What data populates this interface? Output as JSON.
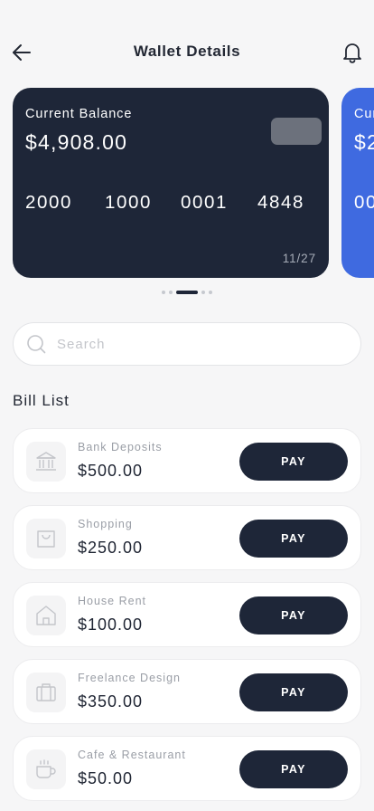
{
  "header": {
    "title": "Wallet Details",
    "back_icon": "arrow-left-icon",
    "notification_icon": "bell-icon"
  },
  "cards": [
    {
      "label": "Current Balance",
      "balance": "$4,908.00",
      "number": [
        "2000",
        "1000",
        "0001",
        "4848"
      ],
      "expiry": "11/27",
      "color": "#1e2638"
    },
    {
      "label": "Current Balance",
      "balance": "$2",
      "number": [
        "00"
      ],
      "color": "#3f6ae0"
    }
  ],
  "carousel": {
    "active_index": 2,
    "count": 5
  },
  "search": {
    "placeholder": "Search",
    "value": "",
    "icon": "search-icon"
  },
  "bills": {
    "title": "Bill List",
    "items": [
      {
        "name": "Bank Deposits",
        "amount": "$500.00",
        "icon": "bank-icon",
        "action": "PAY"
      },
      {
        "name": "Shopping",
        "amount": "$250.00",
        "icon": "shopping-bag-icon",
        "action": "PAY"
      },
      {
        "name": "House Rent",
        "amount": "$100.00",
        "icon": "house-icon",
        "action": "PAY"
      },
      {
        "name": "Freelance Design",
        "amount": "$350.00",
        "icon": "briefcase-icon",
        "action": "PAY"
      },
      {
        "name": "Cafe & Restaurant",
        "amount": "$50.00",
        "icon": "coffee-cup-icon",
        "action": "PAY"
      }
    ]
  },
  "colors": {
    "primary": "#1e2638",
    "accent": "#3f6ae0",
    "background": "#f6f6f7"
  }
}
